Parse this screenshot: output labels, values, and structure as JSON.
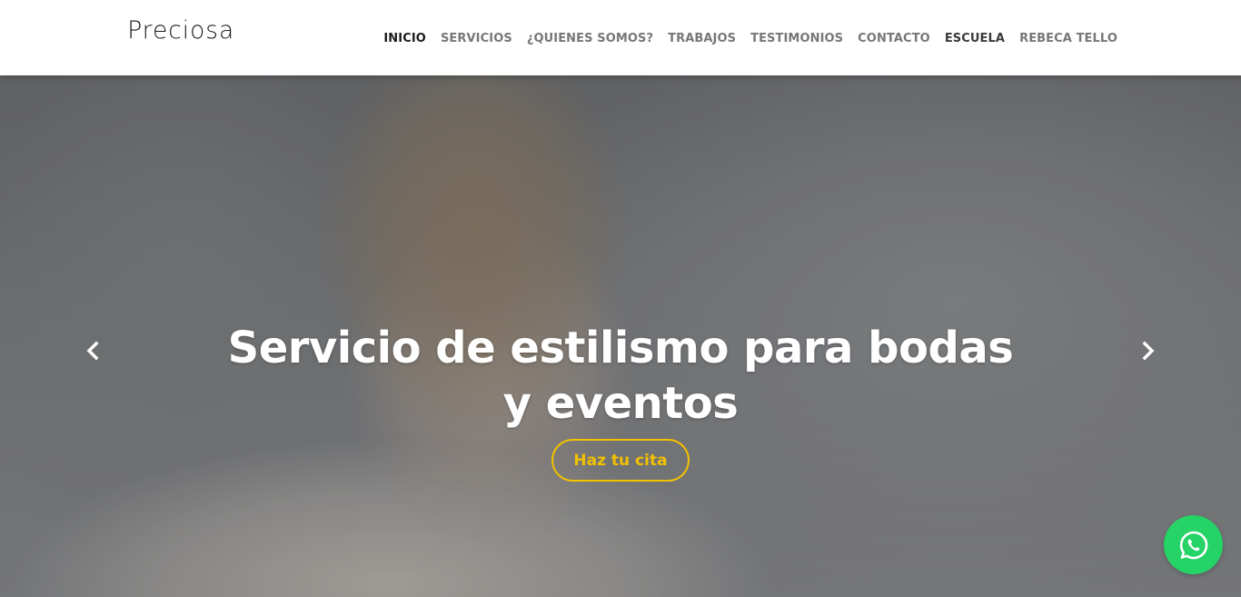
{
  "brand": {
    "logo_text": "Preciosa"
  },
  "nav": {
    "items": [
      {
        "label": "INICIO"
      },
      {
        "label": "SERVICIOS"
      },
      {
        "label": "¿QUIENES SOMOS?"
      },
      {
        "label": "TRABAJOS"
      },
      {
        "label": "TESTIMONIOS"
      },
      {
        "label": "CONTACTO"
      },
      {
        "label": "ESCUELA"
      },
      {
        "label": "REBECA TELLO"
      }
    ],
    "active_item": "INICIO"
  },
  "hero": {
    "title": "Servicio de estilismo para bodas y eventos",
    "cta_label": "Haz tu cita",
    "prev_icon": "chevron-left-icon",
    "next_icon": "chevron-right-icon"
  },
  "floating": {
    "icon": "whatsapp-icon"
  },
  "colors": {
    "accent": "#f2c100",
    "whatsapp": "#25d366",
    "nav_text": "#777777",
    "nav_active": "#1c1c1c"
  }
}
